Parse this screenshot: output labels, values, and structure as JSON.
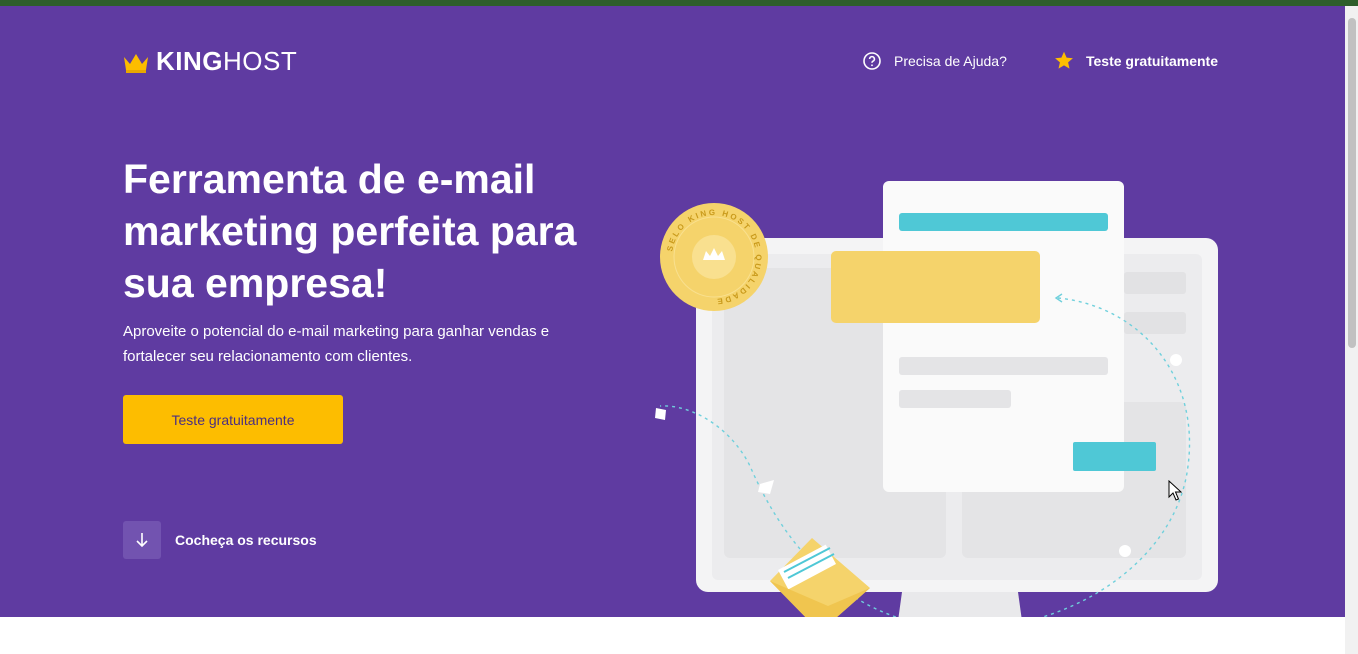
{
  "brand": {
    "logo_bold": "KING",
    "logo_light": "HOST",
    "accent": "#fdbd00",
    "hero_bg": "#5f3ba1"
  },
  "header": {
    "help_label": "Precisa de Ajuda?",
    "trial_label": "Teste gratuitamente",
    "help_icon": "question-bubble-icon",
    "trial_icon": "star-icon"
  },
  "hero": {
    "title": "Ferramenta de e-mail marketing perfeita para sua empresa!",
    "subtitle": "Aproveite o potencial do e-mail marketing para ganhar vendas e fortalecer seu relacionamento com clientes.",
    "cta_label": "Teste gratuitamente",
    "resources_label": "Cocheça os recursos",
    "resources_icon": "arrow-down-icon"
  },
  "seal": {
    "text": "SELO KING HOST DE QUALIDADE"
  }
}
